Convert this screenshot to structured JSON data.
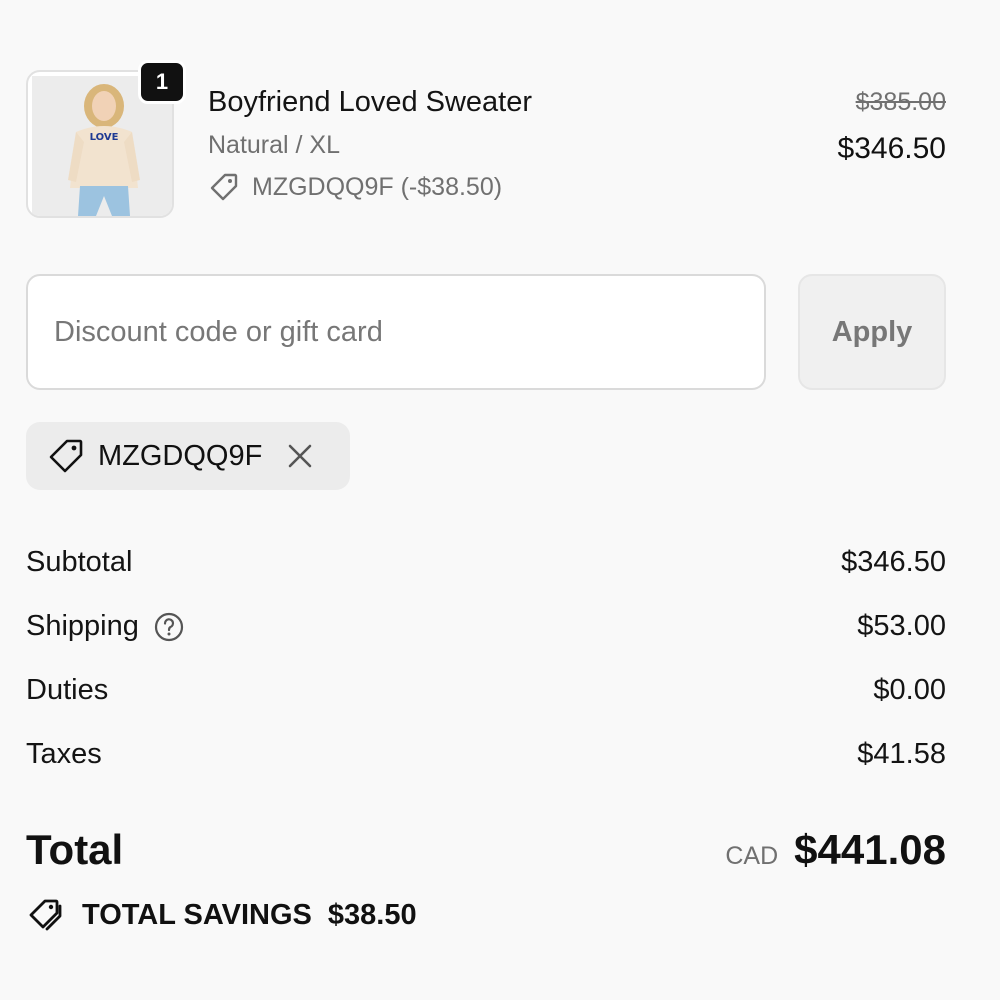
{
  "line_item": {
    "quantity": "1",
    "name": "Boyfriend Loved Sweater",
    "variant": "Natural / XL",
    "discount_code": "MZGDQQ9F (-$38.50)",
    "compare_at_price": "$385.00",
    "price": "$346.50",
    "thumbnail_text": "LOVE"
  },
  "discount": {
    "placeholder": "Discount code or gift card",
    "value": "",
    "apply_label": "Apply",
    "applied_code": "MZGDQQ9F"
  },
  "summary": {
    "subtotal_label": "Subtotal",
    "subtotal_value": "$346.50",
    "shipping_label": "Shipping",
    "shipping_value": "$53.00",
    "duties_label": "Duties",
    "duties_value": "$0.00",
    "taxes_label": "Taxes",
    "taxes_value": "$41.58",
    "total_label": "Total",
    "currency": "CAD",
    "total_value": "$441.08",
    "savings_label": "TOTAL SAVINGS",
    "savings_value": "$38.50"
  },
  "icons": {
    "tag": "tag-icon",
    "close": "close-icon",
    "help": "help-circle-icon",
    "savings": "savings-tag-icon"
  },
  "colors": {
    "text": "#111111",
    "muted": "#707070",
    "badge": "#111111"
  }
}
